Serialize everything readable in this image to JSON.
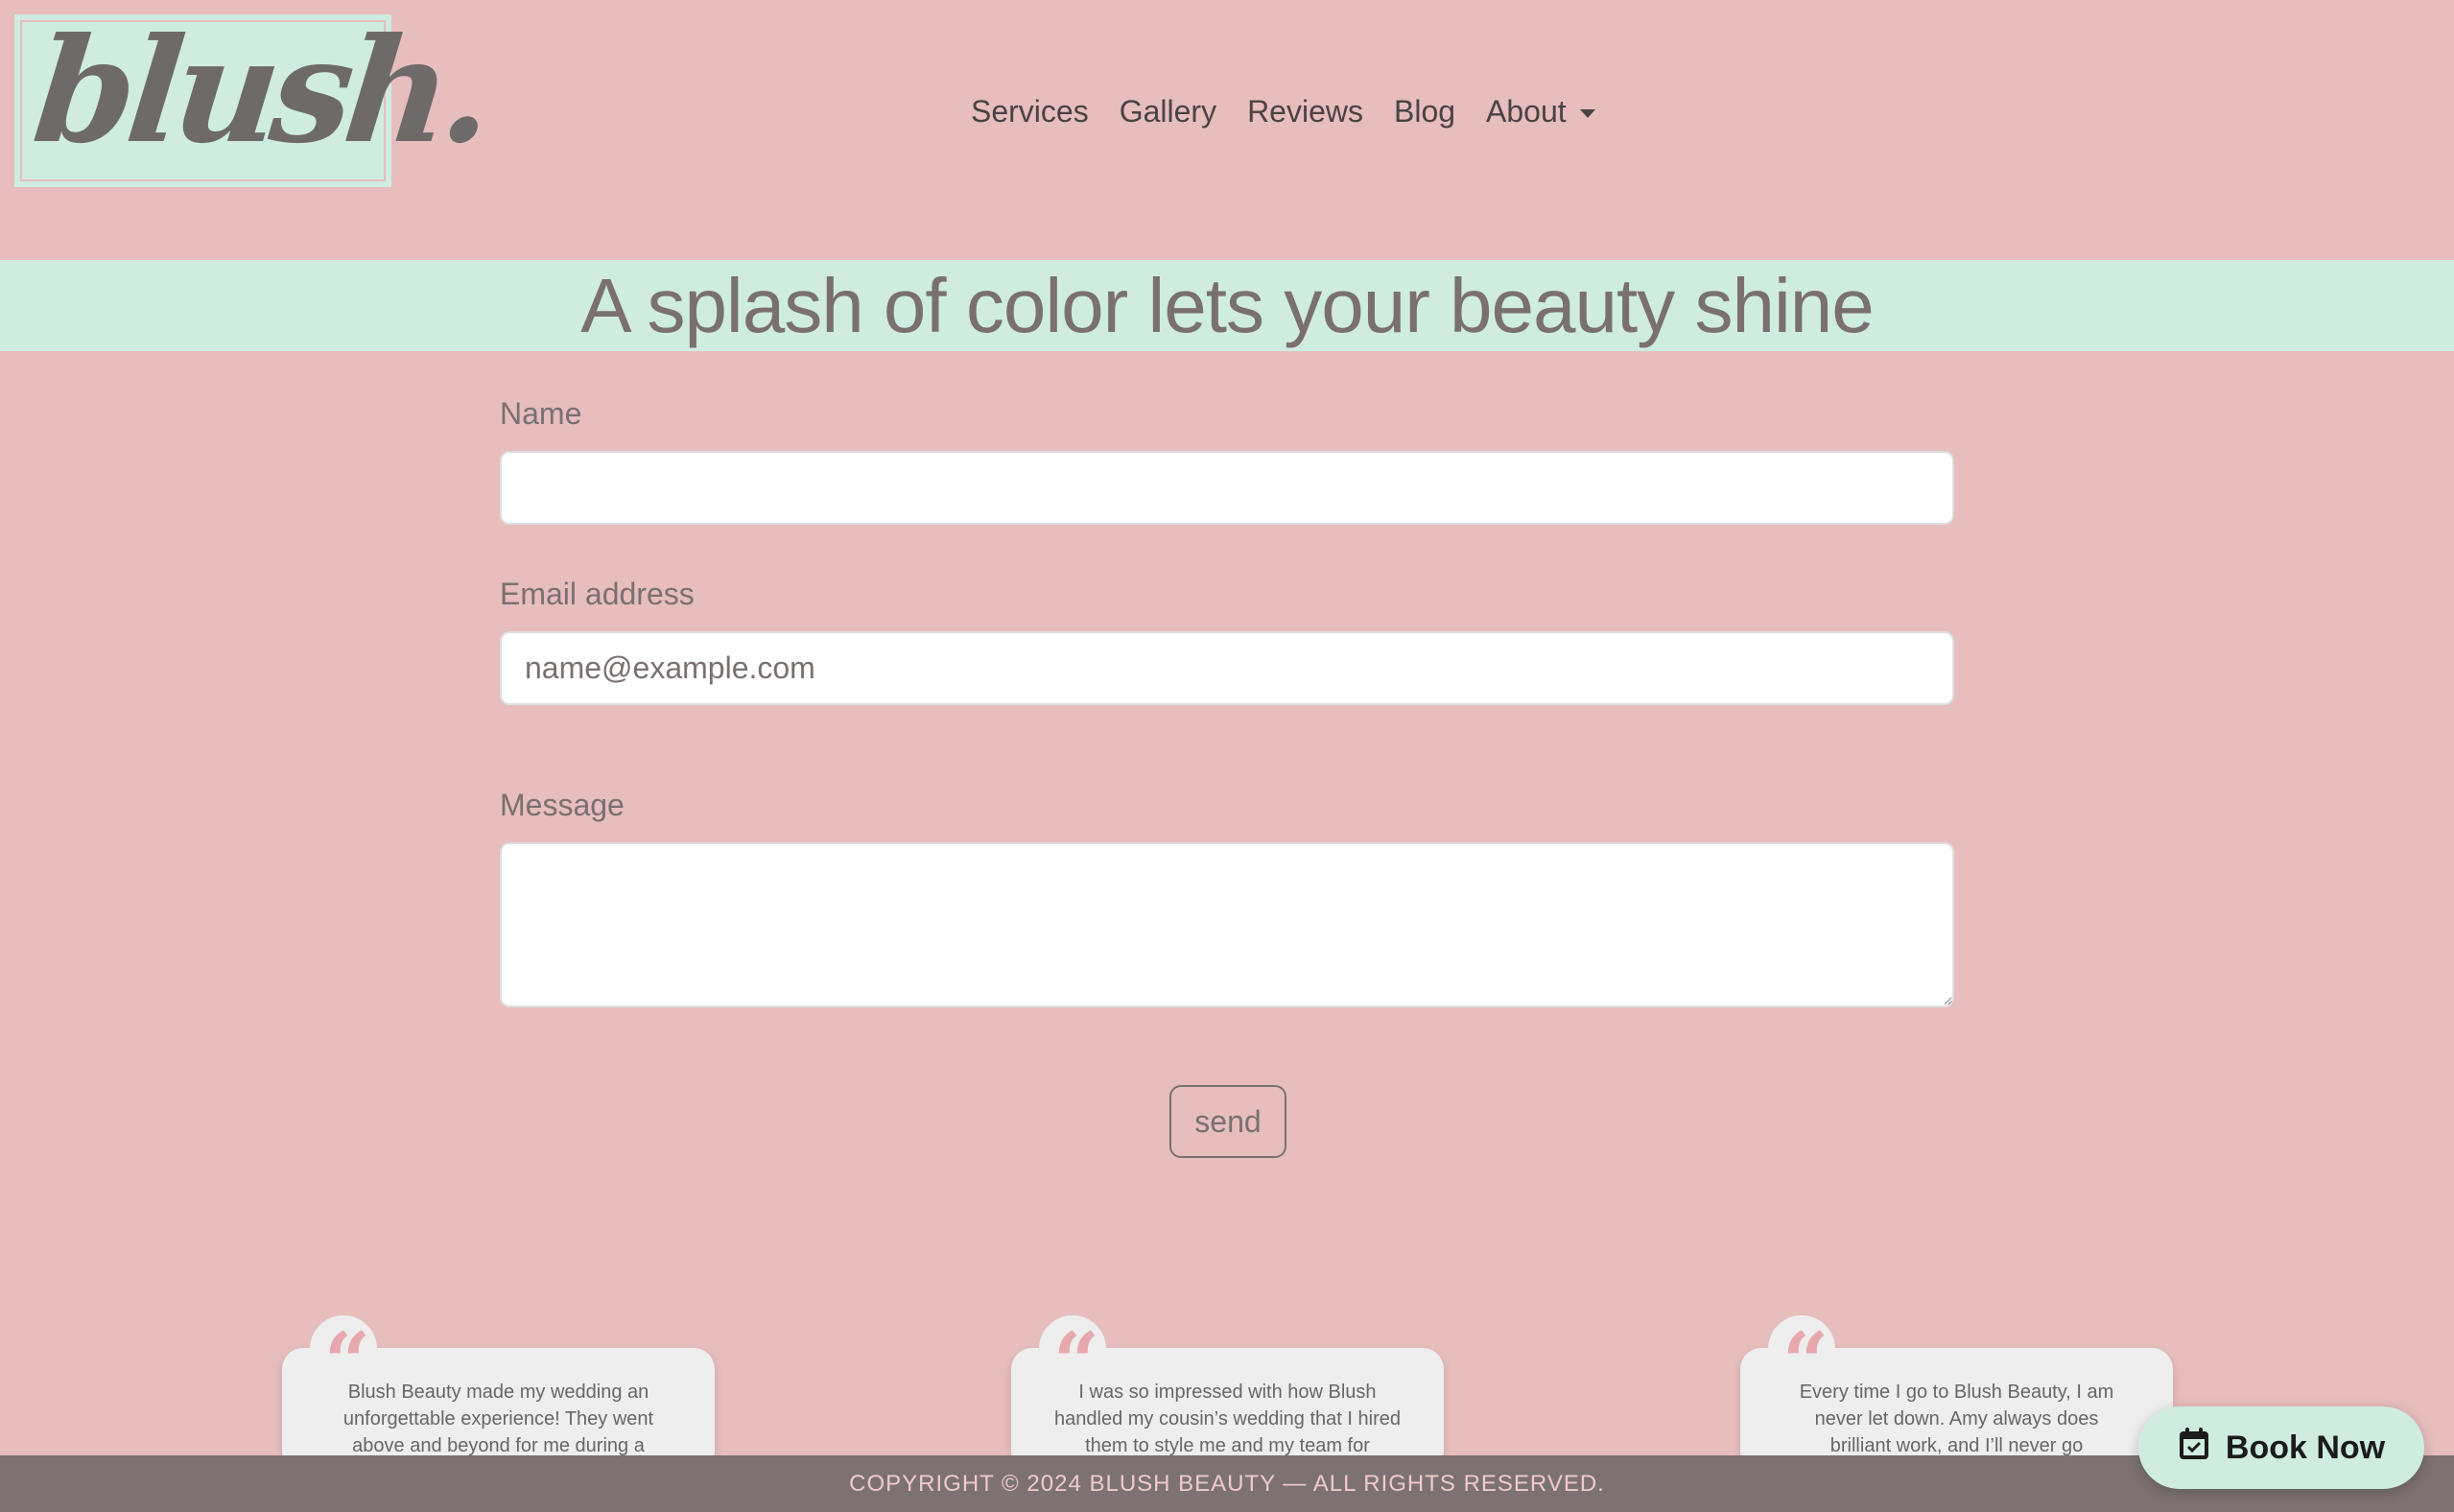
{
  "brand": {
    "logo_text": "blush."
  },
  "nav": {
    "items": [
      "Services",
      "Gallery",
      "Reviews",
      "Blog"
    ],
    "about_label": "About"
  },
  "hero": {
    "title": "A splash of color lets your beauty shine"
  },
  "form": {
    "name_label": "Name",
    "name_value": "",
    "email_label": "Email address",
    "email_placeholder": "name@example.com",
    "message_label": "Message",
    "message_value": "",
    "send_label": "send"
  },
  "testimonials": [
    {
      "icon": "quote-icon",
      "text": "Blush Beauty made my wedding an unforgettable experience! They went above and beyond for me during a"
    },
    {
      "icon": "quote-icon",
      "text": "I was so impressed with how Blush handled my cousin’s wedding that I hired them to style me and my team for"
    },
    {
      "icon": "quote-icon",
      "text": "Every time I go to Blush Beauty, I am never let down. Amy always does brilliant work, and I’ll never go"
    }
  ],
  "footer": {
    "copyright": "COPYRIGHT © 2024 BLUSH BEAUTY — ALL RIGHTS RESERVED."
  },
  "book_now": {
    "label": "Book Now",
    "icon": "calendar-check-icon"
  },
  "colors": {
    "background": "#e7bdbe",
    "mint": "#cfece0",
    "text": "#7a7070",
    "footer": "#7c7272"
  }
}
